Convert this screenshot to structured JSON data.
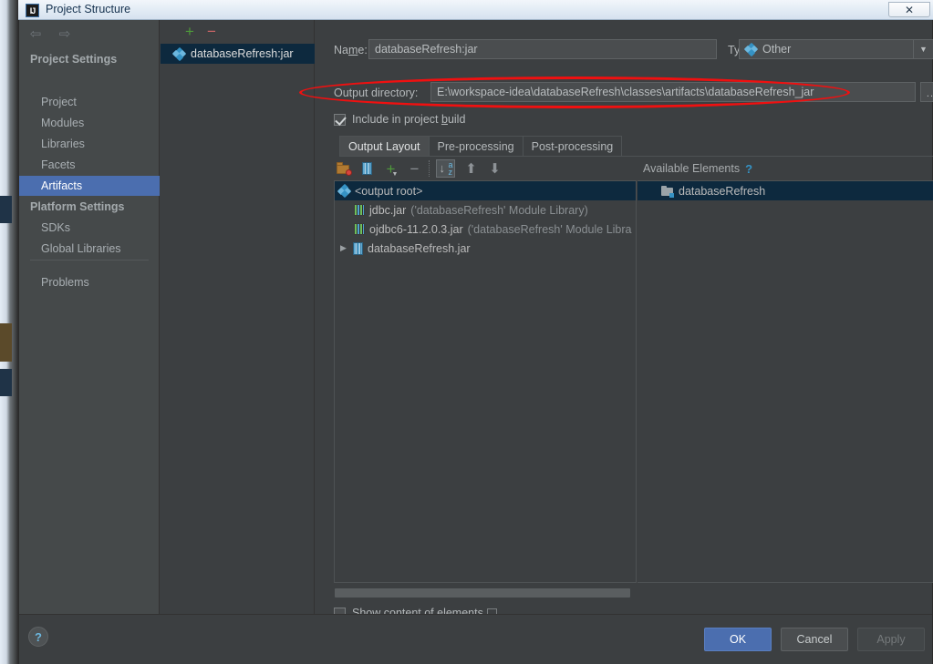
{
  "window": {
    "title": "Project Structure",
    "app_icon": "intellij-idea-icon",
    "close_label": "✕"
  },
  "sidebar": {
    "nav": {
      "back": "⇦",
      "forward": "⇨"
    },
    "groups": [
      {
        "label": "Project Settings",
        "items": [
          {
            "label": "Project",
            "selected": false
          },
          {
            "label": "Modules",
            "selected": false
          },
          {
            "label": "Libraries",
            "selected": false
          },
          {
            "label": "Facets",
            "selected": false
          },
          {
            "label": "Artifacts",
            "selected": true
          }
        ]
      },
      {
        "label": "Platform Settings",
        "items": [
          {
            "label": "SDKs",
            "selected": false
          },
          {
            "label": "Global Libraries",
            "selected": false
          }
        ]
      }
    ],
    "problems": "Problems"
  },
  "artifact_panel": {
    "add_label": "+",
    "remove_label": "−",
    "items": [
      {
        "label": "databaseRefresh:jar",
        "icon": "artifact-diamond-icon",
        "selected": true
      }
    ]
  },
  "editor": {
    "name_label_pre": "Na",
    "name_label_mnemonic": "m",
    "name_label_post": "e:",
    "name_value": "databaseRefresh:jar",
    "type_label": "Type:",
    "type_value": "Other",
    "type_arrow": "▼",
    "output_dir_label": "Output directory:",
    "output_dir_value": "E:\\workspace-idea\\databaseRefresh\\classes\\artifacts\\databaseRefresh_jar",
    "browse_label": "...",
    "include_in_build": {
      "label_pre": "Include in project ",
      "label_mnemonic": "b",
      "label_post": "uild",
      "checked": true
    },
    "tabs": [
      {
        "label": "Output Layout",
        "active": true
      },
      {
        "label": "Pre-processing",
        "active": false
      },
      {
        "label": "Post-processing",
        "active": false
      }
    ],
    "toolbar": [
      {
        "name": "create-directory-button",
        "icon": "folder-config-icon"
      },
      {
        "name": "create-archive-button",
        "icon": "archive-icon"
      },
      {
        "name": "add-copy-of-button",
        "icon": "plus-dropdown-icon"
      },
      {
        "name": "remove-button",
        "icon": "minus-icon"
      },
      {
        "name": "sort-button",
        "icon": "sort-alpha-icon",
        "pressed": true
      },
      {
        "name": "move-up-button",
        "icon": "arrow-up-icon"
      },
      {
        "name": "move-down-button",
        "icon": "arrow-down-icon"
      }
    ],
    "output_tree": [
      {
        "label": "<output root>",
        "suffix": "",
        "icon": "artifact-diamond-icon",
        "indent": 0,
        "selected": true,
        "expandable": false
      },
      {
        "label": "jdbc.jar",
        "suffix": " ('databaseRefresh' Module Library)",
        "icon": "library-icon",
        "indent": 1,
        "selected": false,
        "expandable": false
      },
      {
        "label": "ojdbc6-11.2.0.3.jar",
        "suffix": " ('databaseRefresh' Module Libra",
        "icon": "library-icon",
        "indent": 1,
        "selected": false,
        "expandable": false
      },
      {
        "label": "databaseRefresh.jar",
        "suffix": "",
        "icon": "archive-icon",
        "indent": 1,
        "selected": false,
        "expandable": true,
        "expander": "▶"
      }
    ],
    "available": {
      "header": "Available Elements",
      "help": "?",
      "items": [
        {
          "label": "databaseRefresh",
          "icon": "module-icon",
          "selected": true
        }
      ]
    },
    "show_content": {
      "label": "Show content of elements",
      "checked": false,
      "extra": "..."
    }
  },
  "footer": {
    "help": "?",
    "ok": "OK",
    "cancel": "Cancel",
    "apply": "Apply"
  },
  "annotation": {
    "shape": "red-ellipse-highlight",
    "color": "#f01010"
  }
}
